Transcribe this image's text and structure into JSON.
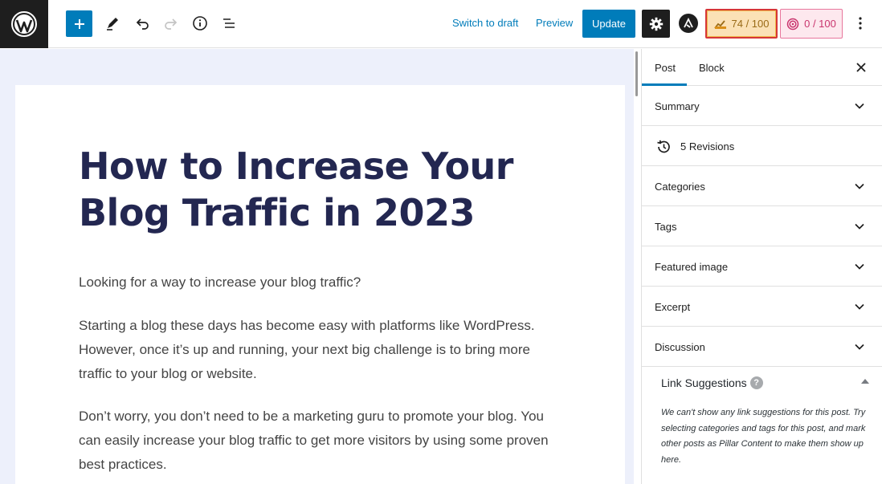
{
  "toolbar": {
    "switch_draft": "Switch to draft",
    "preview": "Preview",
    "update": "Update",
    "seo_score": "74 / 100",
    "readability_score": "0 / 100"
  },
  "post": {
    "title": "How to Increase Your Blog Traffic in 2023",
    "paragraphs": [
      "Looking for a way to increase your blog traffic?",
      "Starting a blog these days has become easy with platforms like WordPress. However, once it’s up and running, your next big challenge is to bring more traffic to your blog or website.",
      "Don’t worry, you don’t need to be a marketing guru to promote your blog. You can easily increase your blog traffic to get more visitors by using some proven best practices."
    ]
  },
  "sidebar": {
    "tabs": [
      "Post",
      "Block"
    ],
    "panels": [
      "Summary",
      "5 Revisions",
      "Categories",
      "Tags",
      "Featured image",
      "Excerpt",
      "Discussion"
    ],
    "link_suggestions": {
      "title": "Link Suggestions",
      "help": "?",
      "text": "We can't show any link suggestions for this post. Try selecting categories and tags for this post, and mark other posts as Pillar Content to make them show up here."
    }
  },
  "colors": {
    "accent": "#007cba",
    "title": "#232751",
    "seo_bg": "#fbe1b6",
    "readability_bg": "#fde8ee"
  }
}
